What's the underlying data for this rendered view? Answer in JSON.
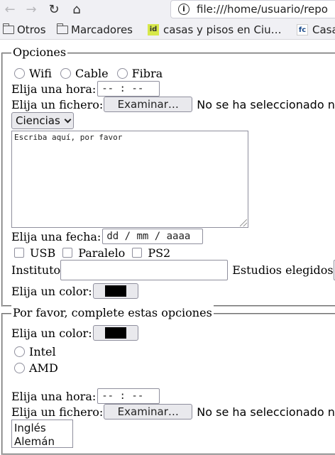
{
  "browser": {
    "url": "file:///home/usuario/repo",
    "bookmarks": [
      {
        "label": "Otros",
        "icon": "folder-icon"
      },
      {
        "label": "Marcadores",
        "icon": "folder-icon"
      },
      {
        "label": "casas y pisos en Ciu…",
        "favicon": "id"
      },
      {
        "label": "Casa",
        "favicon": "fc"
      }
    ]
  },
  "section1": {
    "legend": "Opciones",
    "connection_options": [
      "Wifi",
      "Cable",
      "Fibra"
    ],
    "time_label": "Elija una hora:",
    "time_placeholder": "-- : --",
    "file_label": "Elija un fichero:",
    "file_button": "Examinar…",
    "file_status": "No se ha seleccionado ni",
    "subject_select": "Ciencias",
    "textarea_text": "Escriba aquí, por favor",
    "date_label": "Elija una fecha:",
    "date_placeholder": "dd / mm / aaaa",
    "ports": [
      "USB",
      "Paralelo",
      "PS2"
    ],
    "institute_label": "Instituto",
    "studies_label": "Estudios elegidos",
    "color_label": "Elija un color:",
    "color_value": "#000000"
  },
  "section2": {
    "legend": "Por favor, complete estas opciones",
    "color_label": "Elija un color:",
    "color_value": "#000000",
    "processor_options": [
      "Intel",
      "AMD"
    ],
    "time_label": "Elija una hora:",
    "time_placeholder": "-- : --",
    "file_label": "Elija un fichero:",
    "file_button": "Examinar…",
    "file_status": "No se ha seleccionado ni",
    "languages": [
      "Inglés",
      "Alemán"
    ]
  }
}
